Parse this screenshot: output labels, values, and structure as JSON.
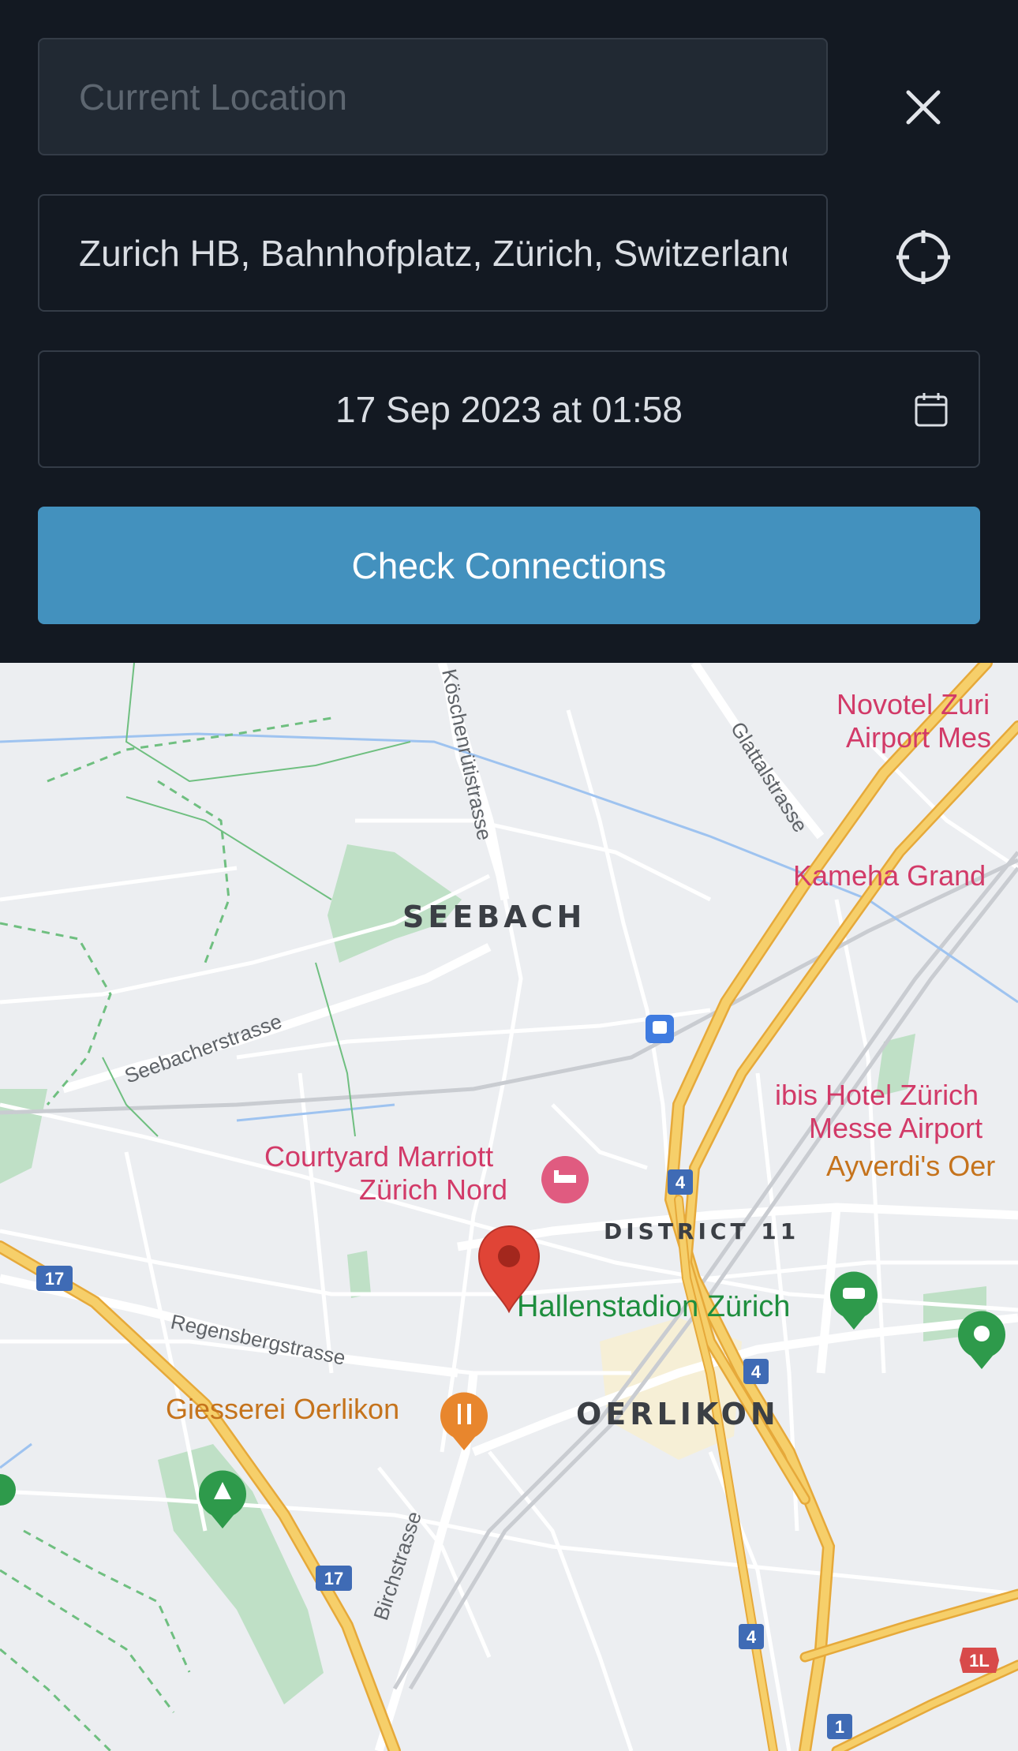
{
  "form": {
    "origin_placeholder": "Current Location",
    "destination_value": "Zurich HB, Bahnhofplatz, Zürich, Switzerland",
    "datetime": "17 Sep 2023 at 01:58",
    "check_button_label": "Check Connections"
  },
  "icons": {
    "close": "close-icon",
    "locate": "crosshair-icon",
    "calendar": "calendar-icon"
  },
  "colors": {
    "panel_bg": "#131922",
    "button_bg": "#4391be",
    "map_bg": "#eceef1",
    "highway": "#f2c14e",
    "pin": "#e04436",
    "poi_red": "#d23a68",
    "poi_green": "#1e8e3e",
    "poi_orange": "#e8862d"
  },
  "map": {
    "districts": {
      "seebach": "SEEBACH",
      "district11": "DISTRICT 11",
      "oerlikon": "OERLIKON"
    },
    "streets": {
      "koschenruti": "Köschenrütistrasse",
      "glattal": "Glattalstrasse",
      "seebacher": "Seebacherstrasse",
      "regensberg": "Regensbergstrasse",
      "birch": "Birchstrasse"
    },
    "pois": {
      "novotel_1": "Novotel Zuri",
      "novotel_2": "Airport Mes",
      "kameha": "Kameha Grand",
      "ibis_1": "ibis Hotel Zürich",
      "ibis_2": "Messe Airport",
      "ayverdi": "Ayverdi's Oer",
      "courtyard_1": "Courtyard Marriott",
      "courtyard_2": "Zürich Nord",
      "hallenstadion": "Hallenstadion Zürich",
      "giesserei": "Giesserei Oerlikon"
    },
    "route_shields": {
      "r17a": "17",
      "r17b": "17",
      "r4a": "4",
      "r4b": "4",
      "r4c": "4",
      "r1": "1",
      "r1l": "1L"
    }
  }
}
